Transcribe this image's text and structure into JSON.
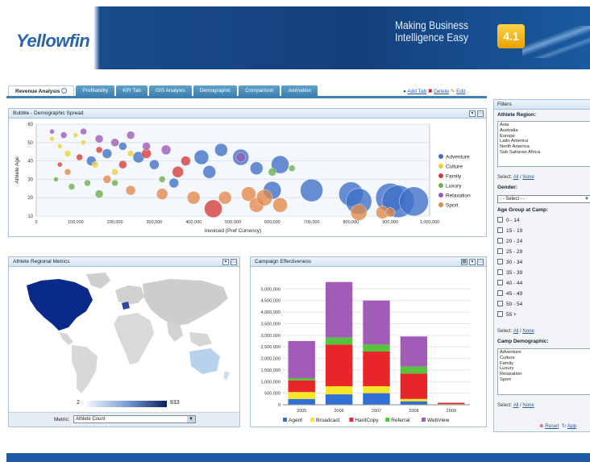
{
  "header": {
    "logo": "Yellowfin",
    "tagline_1": "Making Business",
    "tagline_2": "Intelligence Easy",
    "version": "4.1"
  },
  "tabs": [
    {
      "label": "Revenue Analysis",
      "active": true
    },
    {
      "label": "Profitability"
    },
    {
      "label": "KPI Tab"
    },
    {
      "label": "GIS Analysis"
    },
    {
      "label": "Demographic"
    },
    {
      "label": "Comparison"
    },
    {
      "label": "Animation"
    }
  ],
  "tab_actions": {
    "add": "Add Tab",
    "delete": "Delete",
    "edit": "Edit"
  },
  "bubble_panel": {
    "title": "Bubble - Demographic Spread"
  },
  "map_panel": {
    "title": "Athlete Regional Metrics",
    "scale_min": "2",
    "scale_max": "833",
    "metric_label": "Metric:",
    "metric_value": "Athlete Count"
  },
  "bar_panel": {
    "title": "Campaign Effectiveness"
  },
  "filters": {
    "title": "Filters",
    "region_label": "Athlete Region:",
    "regions": [
      "Asia",
      "Australia",
      "Europe",
      "Latin America",
      "North America",
      "Sub Saharan Africa"
    ],
    "select_label": "Select:",
    "all": "All",
    "sep": "/",
    "none": "None",
    "gender_label": "Gender:",
    "gender_value": "- - Select - -",
    "age_label": "Age Group at Camp:",
    "ages": [
      "0 - 14",
      "15 - 19",
      "20 - 24",
      "25 - 29",
      "30 - 34",
      "35 - 39",
      "40 - 44",
      "45 - 49",
      "50 - 54",
      "55 +"
    ],
    "camp_label": "Camp Demographic:",
    "camps": [
      "Adventure",
      "Culture",
      "Family",
      "Luxury",
      "Relaxation",
      "Sport"
    ],
    "reset": "Reset",
    "apply": "App"
  },
  "chart_data": [
    {
      "type": "scatter",
      "title": "Bubble - Demographic Spread",
      "xlabel": "Invoiced (Pref Currency)",
      "ylabel": "Athlete Age",
      "xlim": [
        0,
        1000000
      ],
      "ylim": [
        10,
        60
      ],
      "xticks": [
        "0",
        "100,000",
        "200,000",
        "300,000",
        "400,000",
        "500,000",
        "600,000",
        "700,000",
        "800,000",
        "900,000",
        "1,000,000"
      ],
      "yticks": [
        "10",
        "20",
        "30",
        "40",
        "50",
        "60"
      ],
      "legend_position": "right",
      "series": [
        {
          "name": "Adventure",
          "color": "#3d6fc6",
          "points": [
            [
              140000,
              40,
              6
            ],
            [
              180000,
              44,
              6
            ],
            [
              220000,
              48,
              5
            ],
            [
              260000,
              42,
              7
            ],
            [
              300000,
              38,
              6
            ],
            [
              350000,
              28,
              6
            ],
            [
              420000,
              42,
              9
            ],
            [
              440000,
              34,
              8
            ],
            [
              470000,
              46,
              8
            ],
            [
              520000,
              42,
              10
            ],
            [
              560000,
              36,
              8
            ],
            [
              600000,
              24,
              11
            ],
            [
              620000,
              38,
              11
            ],
            [
              700000,
              24,
              14
            ],
            [
              800000,
              22,
              15
            ],
            [
              820000,
              18,
              16
            ],
            [
              900000,
              20,
              18
            ],
            [
              920000,
              18,
              20
            ],
            [
              960000,
              18,
              18
            ]
          ]
        },
        {
          "name": "Culture",
          "color": "#e8d23a",
          "points": [
            [
              40000,
              52,
              3
            ],
            [
              60000,
              48,
              3
            ],
            [
              80000,
              44,
              4
            ],
            [
              100000,
              54,
              3
            ],
            [
              120000,
              50,
              3
            ],
            [
              150000,
              38,
              4
            ],
            [
              200000,
              34,
              4
            ],
            [
              240000,
              44,
              4
            ]
          ]
        },
        {
          "name": "Family",
          "color": "#d33b3b",
          "points": [
            [
              60000,
              38,
              3
            ],
            [
              110000,
              42,
              4
            ],
            [
              160000,
              46,
              4
            ],
            [
              220000,
              38,
              5
            ],
            [
              280000,
              44,
              6
            ],
            [
              360000,
              34,
              7
            ],
            [
              380000,
              40,
              6
            ],
            [
              450000,
              14,
              11
            ]
          ]
        },
        {
          "name": "Luxury",
          "color": "#6ab04c",
          "points": [
            [
              50000,
              30,
              3
            ],
            [
              90000,
              26,
              4
            ],
            [
              130000,
              28,
              4
            ],
            [
              160000,
              22,
              5
            ],
            [
              200000,
              28,
              4
            ],
            [
              320000,
              30,
              4
            ],
            [
              600000,
              34,
              5
            ],
            [
              650000,
              36,
              4
            ]
          ]
        },
        {
          "name": "Relaxation",
          "color": "#9b59b6",
          "points": [
            [
              40000,
              56,
              3
            ],
            [
              70000,
              54,
              4
            ],
            [
              120000,
              56,
              4
            ],
            [
              160000,
              52,
              5
            ],
            [
              200000,
              50,
              5
            ],
            [
              240000,
              54,
              5
            ],
            [
              280000,
              48,
              5
            ],
            [
              330000,
              46,
              6
            ],
            [
              520000,
              42,
              6
            ]
          ]
        },
        {
          "name": "Sport",
          "color": "#e0894a",
          "points": [
            [
              80000,
              34,
              4
            ],
            [
              180000,
              30,
              5
            ],
            [
              240000,
              24,
              6
            ],
            [
              320000,
              22,
              7
            ],
            [
              400000,
              20,
              8
            ],
            [
              480000,
              20,
              8
            ],
            [
              540000,
              22,
              9
            ],
            [
              560000,
              16,
              9
            ],
            [
              580000,
              20,
              10
            ],
            [
              620000,
              16,
              9
            ],
            [
              820000,
              12,
              10
            ],
            [
              880000,
              12,
              8
            ],
            [
              900000,
              12,
              6
            ]
          ]
        }
      ]
    },
    {
      "type": "bar",
      "title": "Campaign Effectiveness",
      "stacked": true,
      "categories": [
        "2005",
        "2006",
        "2007",
        "2008",
        "2009"
      ],
      "ylim": [
        0,
        5500000
      ],
      "yticks": [
        "0",
        "500,000",
        "1,000,000",
        "1,500,000",
        "2,000,000",
        "2,500,000",
        "3,000,000",
        "3,500,000",
        "4,000,000",
        "4,500,000",
        "5,000,000"
      ],
      "legend_position": "bottom",
      "series": [
        {
          "name": "Agent",
          "color": "#2f6fd6",
          "values": [
            250000,
            450000,
            500000,
            150000,
            20000
          ]
        },
        {
          "name": "Broadcast",
          "color": "#f5e62a",
          "values": [
            300000,
            350000,
            300000,
            100000,
            10000
          ]
        },
        {
          "name": "HardCopy",
          "color": "#e8262a",
          "values": [
            500000,
            1800000,
            1500000,
            1100000,
            50000
          ]
        },
        {
          "name": "Referral",
          "color": "#55c43c",
          "values": [
            100000,
            300000,
            300000,
            300000,
            5000
          ]
        },
        {
          "name": "WebView",
          "color": "#a35bb8",
          "values": [
            1600000,
            2400000,
            1900000,
            1300000,
            10000
          ]
        }
      ]
    }
  ]
}
